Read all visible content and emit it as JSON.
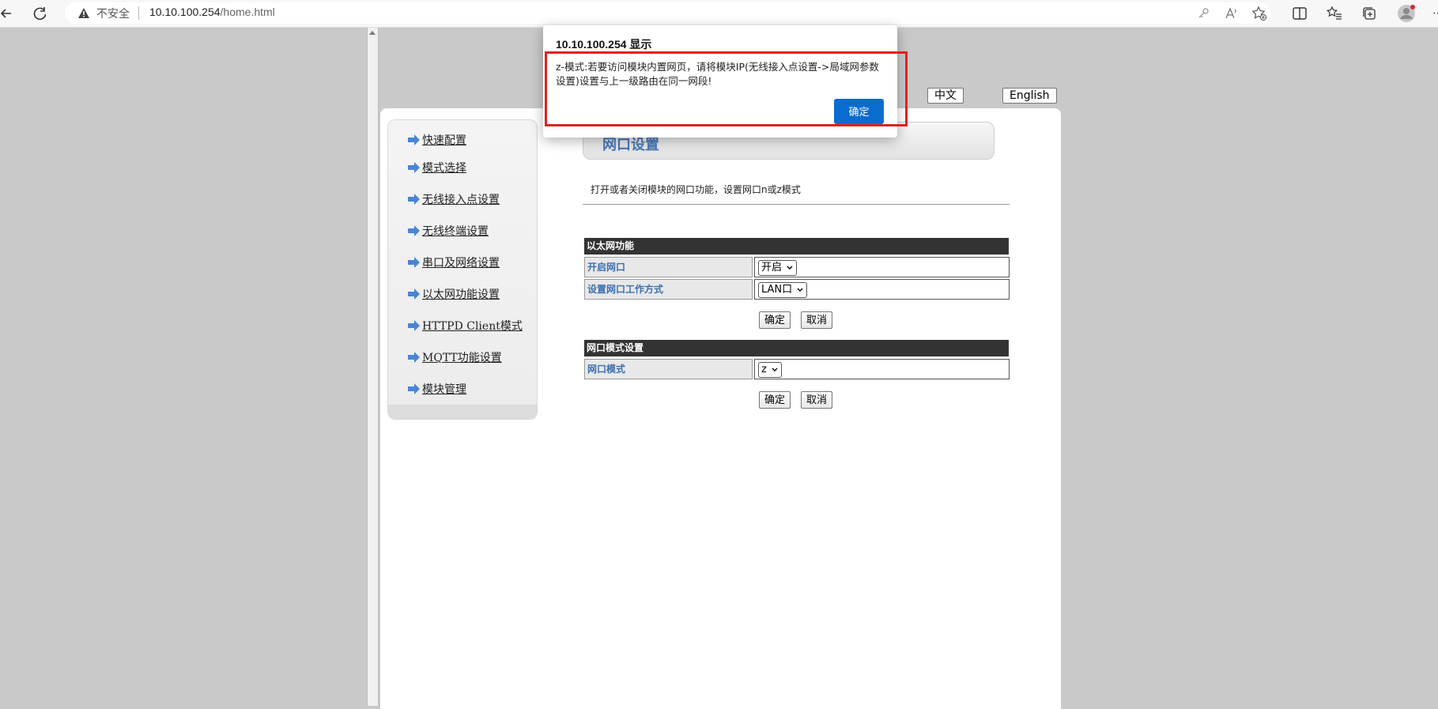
{
  "browser": {
    "security_label": "不安全",
    "url_host": "10.10.100.254",
    "url_path": "/home.html"
  },
  "lang": {
    "zh": "中文",
    "en": "English"
  },
  "sidebar": {
    "items": [
      {
        "label": "快速配置"
      },
      {
        "label": "模式选择"
      },
      {
        "label": "无线接入点设置"
      },
      {
        "label": "无线终端设置"
      },
      {
        "label": "串口及网络设置"
      },
      {
        "label": "以太网功能设置"
      },
      {
        "label": "HTTPD Client模式"
      },
      {
        "label": "MQTT功能设置"
      },
      {
        "label": "模块管理"
      }
    ]
  },
  "main": {
    "title": "网口设置",
    "description": "打开或者关闭模块的网口功能，设置网口n或z模式",
    "ethernet": {
      "header": "以太网功能",
      "enable_label": "开启网口",
      "enable_value": "开启",
      "mode_label": "设置网口工作方式",
      "mode_value": "LAN口",
      "ok": "确定",
      "cancel": "取消"
    },
    "port_mode": {
      "header": "网口模式设置",
      "label": "网口模式",
      "value": "z",
      "ok": "确定",
      "cancel": "取消"
    }
  },
  "dialog": {
    "origin": "10.10.100.254 显示",
    "message": "z-模式:若要访问模块内置网页，请将模块IP(无线接入点设置->局域网参数设置)设置与上一级路由在同一网段!",
    "ok": "确定"
  },
  "colors": {
    "accent": "#4a78b8",
    "dialog_button": "#0b6cd0",
    "highlight_box": "#e02020"
  }
}
